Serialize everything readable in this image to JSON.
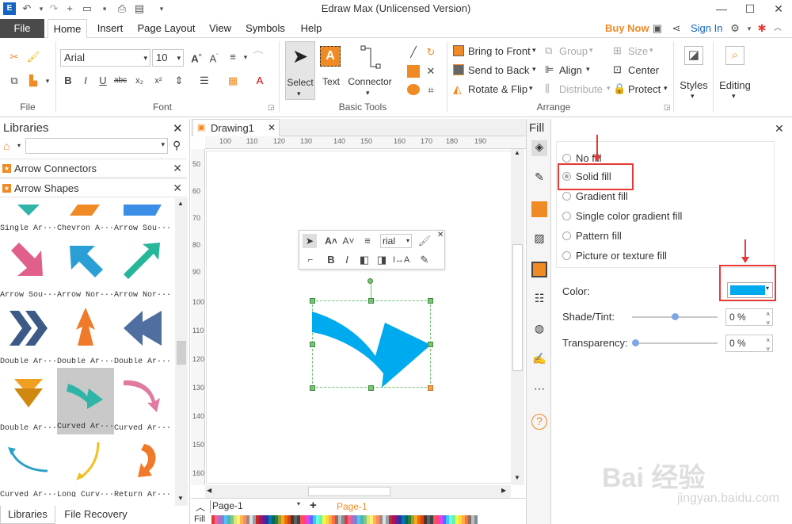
{
  "titlebar": {
    "title": "Edraw Max (Unlicensed Version)"
  },
  "menu": {
    "file": "File",
    "tabs": [
      "Home",
      "Insert",
      "Page Layout",
      "View",
      "Symbols",
      "Help"
    ],
    "buy_now": "Buy Now",
    "sign_in": "Sign In"
  },
  "ribbon": {
    "font_name": "Arial",
    "font_size": "10",
    "groups": {
      "file": "File",
      "font": "Font",
      "basic_tools": "Basic Tools",
      "arrange": "Arrange"
    },
    "tools": {
      "select": "Select",
      "text": "Text",
      "connector": "Connector"
    },
    "arrange": {
      "bring_front": "Bring to Front",
      "send_back": "Send to Back",
      "rotate_flip": "Rotate & Flip",
      "group": "Group",
      "align": "Align",
      "distribute": "Distribute",
      "size": "Size",
      "center": "Center",
      "protect": "Protect"
    },
    "styles": "Styles",
    "editing": "Editing"
  },
  "libraries": {
    "title": "Libraries",
    "sections": [
      "Arrow Connectors",
      "Arrow Shapes"
    ],
    "shapes": [
      {
        "label": "Single Ar···",
        "icon": "down-triangle",
        "color": "#2fb5a8"
      },
      {
        "label": "Chevron A···",
        "icon": "chevron",
        "color": "#f08a24"
      },
      {
        "label": "Arrow Sou···",
        "icon": "blue-parallelogram",
        "color": "#3a8ee6"
      },
      {
        "label": "Arrow Sou···",
        "icon": "arrow-southeast",
        "color": "#e0608a"
      },
      {
        "label": "Arrow Nor···",
        "icon": "arrow-northwest",
        "color": "#2a9fd6"
      },
      {
        "label": "Arrow Nor···",
        "icon": "arrow-northeast",
        "color": "#26b79a"
      },
      {
        "label": "Double Ar···",
        "icon": "double-chevron",
        "color": "#3b5a86"
      },
      {
        "label": "Double Ar···",
        "icon": "double-up-arrow",
        "color": "#f07a2a"
      },
      {
        "label": "Double Ar···",
        "icon": "double-left-arrow",
        "color": "#4f6fa0"
      },
      {
        "label": "Double Ar···",
        "icon": "double-down-arrow",
        "color": "#f0a020"
      },
      {
        "label": "Curved Ar···",
        "icon": "curved-arrow",
        "color": "#2fb5a8"
      },
      {
        "label": "Curved Ar···",
        "icon": "curved-arrow-pink",
        "color": "#e07aa0"
      },
      {
        "label": "Curved Ar···",
        "icon": "curved-line-arrow",
        "color": "#2aa0c8"
      },
      {
        "label": "Long Curv···",
        "icon": "long-curved-arrow",
        "color": "#f0c020"
      },
      {
        "label": "Return Ar···",
        "icon": "return-arrow",
        "color": "#f07a2a"
      }
    ],
    "bottom_tabs": [
      "Libraries",
      "File Recovery"
    ]
  },
  "canvas": {
    "doc_tab": "Drawing1",
    "ruler_h": [
      "100",
      "110",
      "120",
      "130",
      "140",
      "150",
      "160",
      "170",
      "180",
      "190"
    ],
    "ruler_v": [
      "50",
      "60",
      "70",
      "80",
      "90",
      "100",
      "110",
      "120",
      "130",
      "140",
      "150",
      "160"
    ],
    "shape_color": "#00aaee",
    "page_selector": "Page-1",
    "active_page": "Page-1",
    "fill_label": "Fill",
    "float_font": "rial"
  },
  "fill": {
    "title": "Fill",
    "options": [
      "No fill",
      "Solid fill",
      "Gradient fill",
      "Single color gradient fill",
      "Pattern fill",
      "Picture or texture fill"
    ],
    "selected": "Solid fill",
    "color_label": "Color:",
    "color_value": "#00aaee",
    "shade_label": "Shade/Tint:",
    "shade_value": "0 %",
    "shade_level": 0.5,
    "transparency_label": "Transparency:",
    "transparency_value": "0 %",
    "transparency_level": 0
  },
  "watermark": {
    "main": "Bai 经验",
    "sub": "jingyan.baidu.com"
  }
}
